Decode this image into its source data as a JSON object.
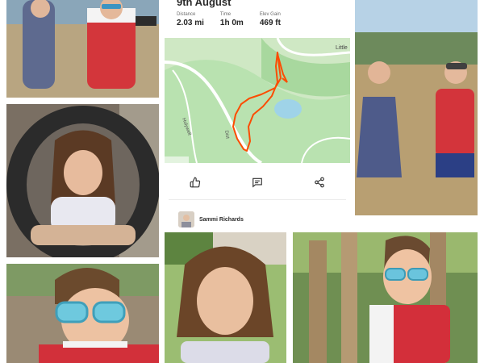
{
  "activity": {
    "date": "9th August",
    "stats": [
      {
        "label": "Distance",
        "value": "2.03 mi"
      },
      {
        "label": "Time",
        "value": "1h 0m"
      },
      {
        "label": "Elev Gain",
        "value": "469 ft"
      }
    ],
    "map_labels": {
      "top_right": "Little",
      "road_left": "Holywell",
      "road_mid": "Dist"
    },
    "actions": {
      "like_icon": "thumbs-up-icon",
      "comment_icon": "comment-icon",
      "share_icon": "share-icon"
    },
    "comment": {
      "author": "Sammi Richards"
    }
  },
  "colors": {
    "route": "#fc4c02",
    "map_green": "#b9e2b0",
    "water": "#9fd3e8"
  }
}
